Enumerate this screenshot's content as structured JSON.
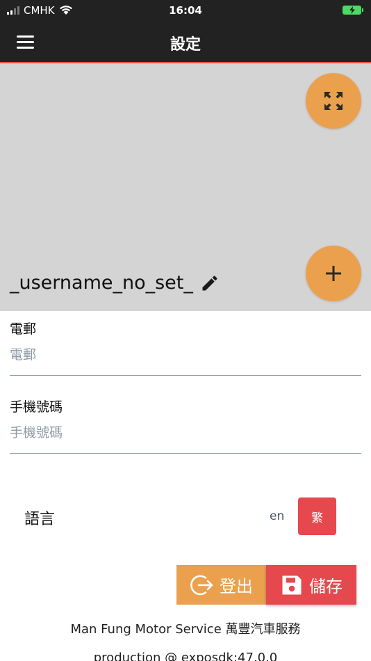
{
  "status_bar": {
    "carrier": "CMHK",
    "time": "16:04"
  },
  "header": {
    "title": "設定"
  },
  "profile": {
    "username": "_username_no_set_"
  },
  "form": {
    "email": {
      "label": "電郵",
      "placeholder": "電郵",
      "value": ""
    },
    "phone": {
      "label": "手機號碼",
      "placeholder": "手機號碼",
      "value": ""
    }
  },
  "language": {
    "label": "語言",
    "options": [
      "en",
      "繁"
    ],
    "selected": "繁"
  },
  "actions": {
    "logout_label": "登出",
    "save_label": "儲存"
  },
  "footer": {
    "company": "Man Fung Motor Service 萬豐汽車服務",
    "version": "production @ exposdk:47.0.0"
  },
  "colors": {
    "header_bg": "#222222",
    "accent_orange": "#eba04e",
    "accent_red": "#e5484d",
    "banner_bg": "#d4d4d4"
  },
  "icons": {
    "menu": "hamburger-menu-icon",
    "expand": "expand-arrows-icon",
    "add": "plus-icon",
    "edit": "pencil-icon",
    "logout": "logout-icon",
    "save": "floppy-disk-icon"
  }
}
